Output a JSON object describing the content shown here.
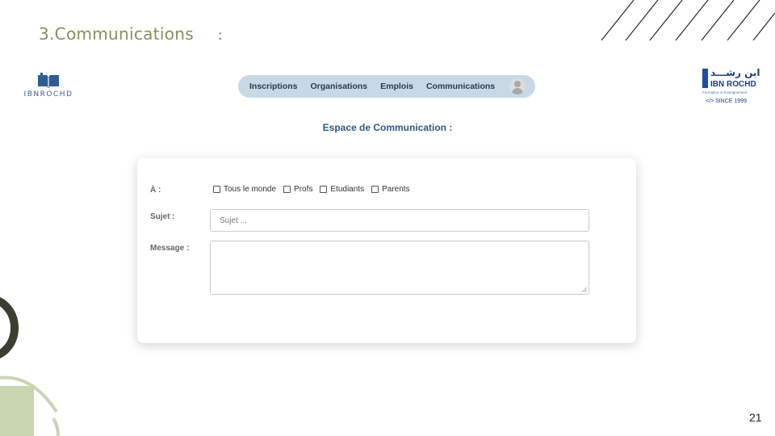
{
  "slide": {
    "title": "3.Communications",
    "colon": ":",
    "page_number": "21"
  },
  "logos": {
    "left_name": "IBNROCHD",
    "right_arabic": "ابن رشـــد",
    "right_name": "IBN ROCHD",
    "right_sub": "Formation et Enseignement",
    "right_since": "</> SINCE 1999"
  },
  "nav": {
    "items": [
      {
        "label": "Inscriptions"
      },
      {
        "label": "Organisations"
      },
      {
        "label": "Emplois"
      },
      {
        "label": "Communications"
      }
    ],
    "avatar_icon": "user-avatar-icon"
  },
  "page": {
    "heading": "Espace de Communication :"
  },
  "form": {
    "to_label": "À :",
    "recipients": [
      {
        "label": "Tous le monde",
        "checked": false
      },
      {
        "label": "Profs",
        "checked": false
      },
      {
        "label": "Etudiants",
        "checked": false
      },
      {
        "label": "Parents",
        "checked": false
      }
    ],
    "subject_label": "Sujet :",
    "subject_placeholder": "Sujet ...",
    "subject_value": "",
    "message_label": "Message :",
    "message_value": ""
  },
  "colors": {
    "title": "#8a8f5a",
    "nav_bg": "#c7d9e7",
    "heading": "#2d5a86",
    "deco_dark": "#3c3f2f",
    "deco_light": "#c9d6b1"
  }
}
